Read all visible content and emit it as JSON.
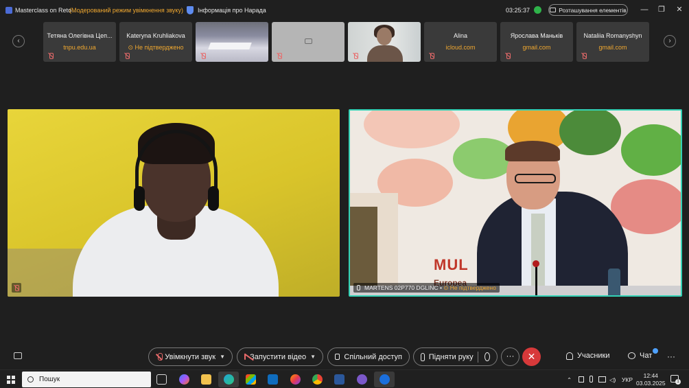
{
  "window": {
    "title": "Masterclass on Reto...",
    "mode": "(Модерований режим увімкнення звуку)",
    "info": "Інформація про Нарада",
    "timer": "03:25:37",
    "layout_button": "Розташування елементів",
    "minimize": "—",
    "restore": "❐",
    "close": "✕"
  },
  "strip": {
    "prev": "‹",
    "next": "›",
    "tiles": [
      {
        "name": "Тетяна Олегівна Цеп...",
        "sub": "tnpu.edu.ua"
      },
      {
        "name": "Kateryna Kruhliakova",
        "sub": "Не підтверджено"
      },
      {
        "name": "",
        "sub": ""
      },
      {
        "name": "",
        "sub": ""
      },
      {
        "name": "",
        "sub": ""
      },
      {
        "name": "Alina",
        "sub": "icloud.com"
      },
      {
        "name": "Ярослава Маньків",
        "sub": "gmail.com"
      },
      {
        "name": "Nataliia Romanyshyn",
        "sub": "gmail.com"
      }
    ]
  },
  "main": {
    "right_name": "MARTENS 02P770 DGLINC",
    "right_sep": "•",
    "right_status": "Не підтверджено",
    "banner": "MUL",
    "banner_sub": "Europea"
  },
  "toolbar": {
    "unmute": "Увімкнути звук",
    "start_video": "Запустити відео",
    "share": "Спільний доступ",
    "raise_hand": "Підняти руку",
    "more": "···",
    "end": "✕",
    "participants": "Учасники",
    "chat": "Чат",
    "more_right": "···"
  },
  "taskbar": {
    "search": "Пошук",
    "lang": "УКР",
    "time": "12:44",
    "date": "03.03.2025",
    "notif_count": "1"
  },
  "colors": {
    "accent_orange": "#f0a830",
    "speaker_border": "#33d2b6",
    "end_call": "#d7393a",
    "rec": "#2fb34a"
  }
}
